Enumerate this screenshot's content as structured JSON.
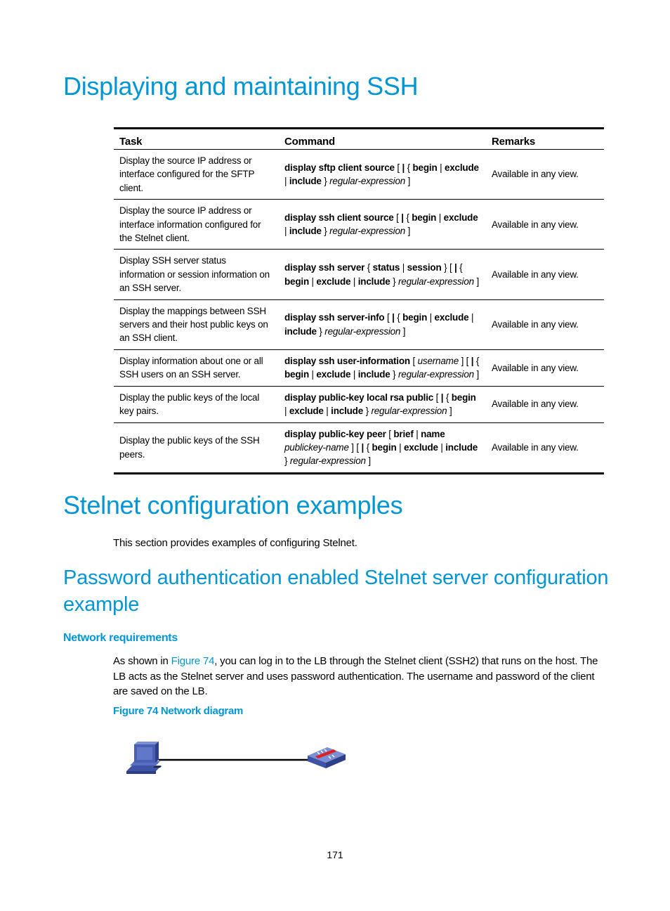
{
  "sections": {
    "displaying_title": "Displaying and maintaining SSH",
    "stelnet_title": "Stelnet configuration examples",
    "stelnet_intro": "This section provides examples of configuring Stelnet.",
    "password_title": "Password authentication enabled Stelnet server configuration example",
    "network_requirements_title": "Network requirements",
    "network_para": {
      "before_link": "As shown in ",
      "link": "Figure 74",
      "after_link": ", you can log in to the LB through the Stelnet client (SSH2) that runs on the host. The LB acts as the Stelnet server and uses password authentication. The username and password of the client are saved on the LB."
    },
    "figure_caption": "Figure 74 Network diagram"
  },
  "table": {
    "headers": [
      "Task",
      "Command",
      "Remarks"
    ],
    "rows": [
      {
        "task": "Display the source IP address or interface configured for the SFTP client.",
        "command": [
          {
            "t": "display sftp client source",
            "s": "kw"
          },
          {
            "t": " [ ",
            "s": ""
          },
          {
            "t": "|",
            "s": "kw"
          },
          {
            "t": " { ",
            "s": ""
          },
          {
            "t": "begin",
            "s": "kw"
          },
          {
            "t": " | ",
            "s": ""
          },
          {
            "t": "exclude",
            "s": "kw"
          },
          {
            "t": " | ",
            "s": ""
          },
          {
            "t": "include",
            "s": "kw"
          },
          {
            "t": " } ",
            "s": ""
          },
          {
            "t": "regular-expression",
            "s": "arg"
          },
          {
            "t": " ]",
            "s": ""
          }
        ],
        "remarks": "Available in any view."
      },
      {
        "task": "Display the source IP address or interface information configured for the Stelnet client.",
        "command": [
          {
            "t": "display ssh client source",
            "s": "kw"
          },
          {
            "t": " [ ",
            "s": ""
          },
          {
            "t": "|",
            "s": "kw"
          },
          {
            "t": " { ",
            "s": ""
          },
          {
            "t": "begin",
            "s": "kw"
          },
          {
            "t": " | ",
            "s": ""
          },
          {
            "t": "exclude",
            "s": "kw"
          },
          {
            "t": " | ",
            "s": ""
          },
          {
            "t": "include",
            "s": "kw"
          },
          {
            "t": " } ",
            "s": ""
          },
          {
            "t": "regular-expression",
            "s": "arg"
          },
          {
            "t": " ]",
            "s": ""
          }
        ],
        "remarks": "Available in any view."
      },
      {
        "task": "Display SSH server status information or session information on an SSH server.",
        "command": [
          {
            "t": "display ssh server",
            "s": "kw"
          },
          {
            "t": " { ",
            "s": ""
          },
          {
            "t": "status",
            "s": "kw"
          },
          {
            "t": " | ",
            "s": ""
          },
          {
            "t": "session",
            "s": "kw"
          },
          {
            "t": " } [ ",
            "s": ""
          },
          {
            "t": "|",
            "s": "kw"
          },
          {
            "t": " { ",
            "s": ""
          },
          {
            "t": "begin",
            "s": "kw"
          },
          {
            "t": " | ",
            "s": ""
          },
          {
            "t": "exclude",
            "s": "kw"
          },
          {
            "t": " | ",
            "s": ""
          },
          {
            "t": "include",
            "s": "kw"
          },
          {
            "t": " } ",
            "s": ""
          },
          {
            "t": "regular-expression",
            "s": "arg"
          },
          {
            "t": " ]",
            "s": ""
          }
        ],
        "remarks": "Available in any view."
      },
      {
        "task": "Display the mappings between SSH servers and their host public keys on an SSH client.",
        "command": [
          {
            "t": "display ssh server-info",
            "s": "kw"
          },
          {
            "t": " [ ",
            "s": ""
          },
          {
            "t": "|",
            "s": "kw"
          },
          {
            "t": " { ",
            "s": ""
          },
          {
            "t": "begin",
            "s": "kw"
          },
          {
            "t": " | ",
            "s": ""
          },
          {
            "t": "exclude",
            "s": "kw"
          },
          {
            "t": " | ",
            "s": ""
          },
          {
            "t": "include",
            "s": "kw"
          },
          {
            "t": " } ",
            "s": ""
          },
          {
            "t": "regular-expression",
            "s": "arg"
          },
          {
            "t": " ]",
            "s": ""
          }
        ],
        "remarks": "Available in any view."
      },
      {
        "task": "Display information about one or all SSH users on an SSH server.",
        "command": [
          {
            "t": "display ssh user-information",
            "s": "kw"
          },
          {
            "t": " [ ",
            "s": ""
          },
          {
            "t": "username",
            "s": "arg"
          },
          {
            "t": " ] [ ",
            "s": ""
          },
          {
            "t": "|",
            "s": "kw"
          },
          {
            "t": " { ",
            "s": ""
          },
          {
            "t": "begin",
            "s": "kw"
          },
          {
            "t": " | ",
            "s": ""
          },
          {
            "t": "exclude",
            "s": "kw"
          },
          {
            "t": " | ",
            "s": ""
          },
          {
            "t": "include",
            "s": "kw"
          },
          {
            "t": " } ",
            "s": ""
          },
          {
            "t": "regular-expression",
            "s": "arg"
          },
          {
            "t": " ]",
            "s": ""
          }
        ],
        "remarks": "Available in any view."
      },
      {
        "task": "Display the public keys of the local key pairs.",
        "command": [
          {
            "t": "display public-key local rsa public",
            "s": "kw"
          },
          {
            "t": " [ ",
            "s": ""
          },
          {
            "t": "|",
            "s": "kw"
          },
          {
            "t": " { ",
            "s": ""
          },
          {
            "t": "begin",
            "s": "kw"
          },
          {
            "t": " | ",
            "s": ""
          },
          {
            "t": "exclude",
            "s": "kw"
          },
          {
            "t": " | ",
            "s": ""
          },
          {
            "t": "include",
            "s": "kw"
          },
          {
            "t": " } ",
            "s": ""
          },
          {
            "t": "regular-expression",
            "s": "arg"
          },
          {
            "t": " ]",
            "s": ""
          }
        ],
        "remarks": "Available in any view."
      },
      {
        "task": "Display the public keys of the SSH peers.",
        "command": [
          {
            "t": "display public-key peer",
            "s": "kw"
          },
          {
            "t": " [ ",
            "s": ""
          },
          {
            "t": "brief",
            "s": "kw"
          },
          {
            "t": " | ",
            "s": ""
          },
          {
            "t": "name",
            "s": "kw"
          },
          {
            "t": " ",
            "s": ""
          },
          {
            "t": "publickey-name",
            "s": "arg"
          },
          {
            "t": " ] [ ",
            "s": ""
          },
          {
            "t": "|",
            "s": "kw"
          },
          {
            "t": " { ",
            "s": ""
          },
          {
            "t": "begin",
            "s": "kw"
          },
          {
            "t": " | ",
            "s": ""
          },
          {
            "t": "exclude",
            "s": "kw"
          },
          {
            "t": " | ",
            "s": ""
          },
          {
            "t": "include",
            "s": "kw"
          },
          {
            "t": " } ",
            "s": ""
          },
          {
            "t": "regular-expression",
            "s": "arg"
          },
          {
            "t": " ]",
            "s": ""
          }
        ],
        "remarks": "Available in any view."
      }
    ]
  },
  "diagram": {
    "nodes": [
      {
        "name": "host",
        "icon": "computer-icon"
      },
      {
        "name": "LB",
        "icon": "load-balancer-icon"
      }
    ],
    "colors": {
      "device": "#4a5fb0",
      "device_light": "#7b8fd6",
      "accent": "#e02020",
      "link": "#000000"
    }
  },
  "footer": {
    "page_number": "171"
  },
  "colors": {
    "heading": "#0096d6",
    "text": "#000000"
  }
}
